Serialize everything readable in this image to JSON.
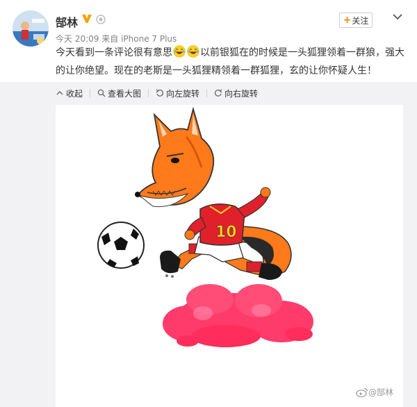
{
  "user": {
    "name": "郜林"
  },
  "header": {
    "follow_label": "关注"
  },
  "post": {
    "time": "今天 20:09",
    "source_prefix": "来自",
    "source": "iPhone 7 Plus",
    "text_part1": "今天看到一条评论很有意思",
    "text_part2": "以前银狐在的时候是一头狐狸领着一群狼，强大的让你绝望。现在的老斯是一头狐狸精领着一群狐狸，玄的让你怀疑人生！"
  },
  "toolbar": {
    "collapse": "收起",
    "view_large": "查看大图",
    "rotate_left": "向左旋转",
    "rotate_right": "向右旋转"
  },
  "image": {
    "jersey_number": "10",
    "watermark": "@郜林"
  },
  "colors": {
    "accent": "#ff8200",
    "verified": "#f8a300",
    "link_gray": "#808080"
  }
}
